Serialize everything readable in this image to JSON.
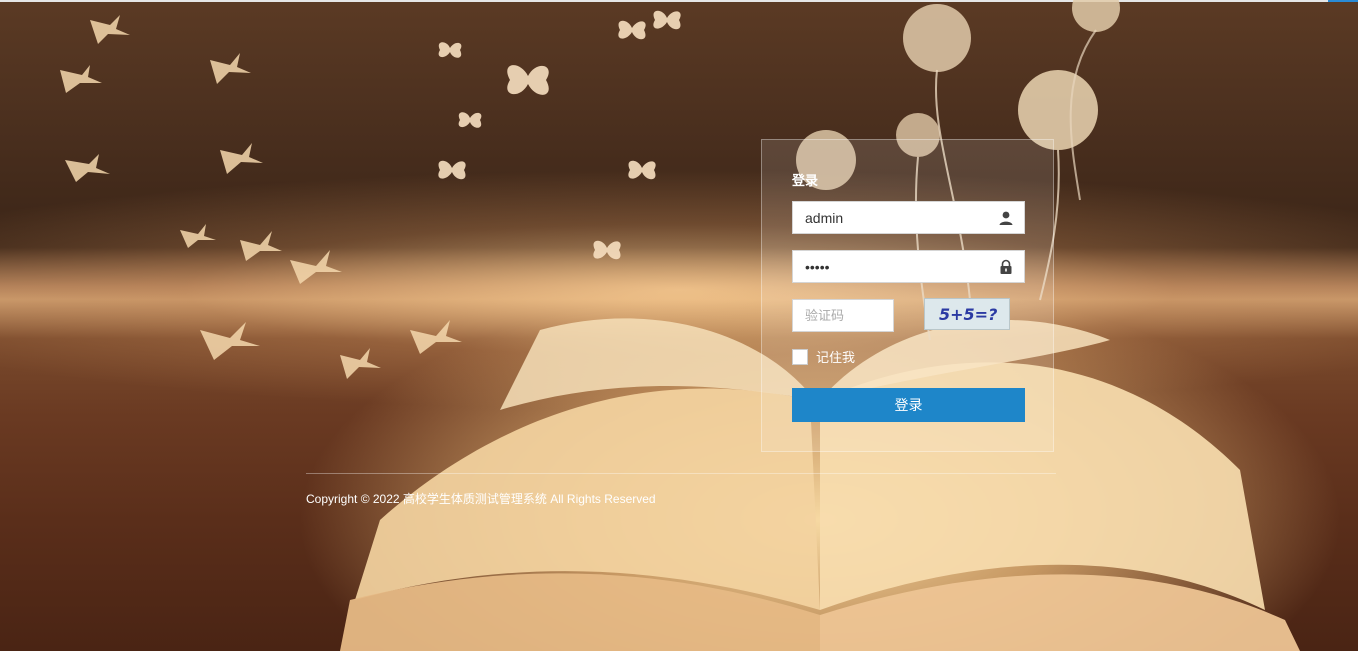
{
  "login": {
    "title": "登录",
    "username_value": "admin",
    "password_value": "•••••",
    "captcha_placeholder": "验证码",
    "captcha_image_text": "5+5=?",
    "remember_label": "记住我",
    "submit_label": "登录"
  },
  "footer": {
    "copyright": "Copyright © 2022 高校学生体质测试管理系统 All Rights Reserved"
  },
  "colors": {
    "accent": "#1e86c9",
    "top_accent": "#2a8bd6"
  },
  "icons": {
    "username": "user-icon",
    "password": "lock-icon"
  }
}
